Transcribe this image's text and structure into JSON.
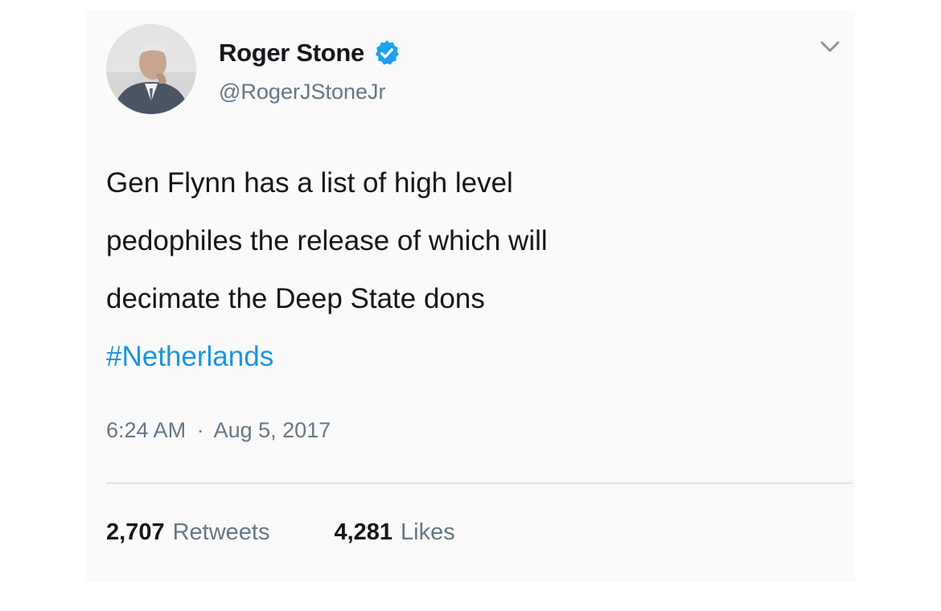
{
  "tweet": {
    "author": {
      "display_name": "Roger Stone",
      "handle": "@RogerJStoneJr",
      "verified": true
    },
    "text_lines": [
      "Gen Flynn has a list of high level",
      "pedophiles the release of which will",
      "decimate the Deep State dons"
    ],
    "hashtag": "#Netherlands",
    "time": "6:24 AM",
    "separator": "·",
    "date": "Aug 5, 2017",
    "stats": {
      "retweets_count": "2,707",
      "retweets_label": "Retweets",
      "likes_count": "4,281",
      "likes_label": "Likes"
    }
  },
  "icons": {
    "verified": "verified-badge-icon",
    "menu": "chevron-down-icon"
  },
  "colors": {
    "text": "#14171a",
    "secondary": "#657786",
    "link": "#1b95e0",
    "verified": "#1da1f2",
    "divider": "#e1e4e6"
  }
}
